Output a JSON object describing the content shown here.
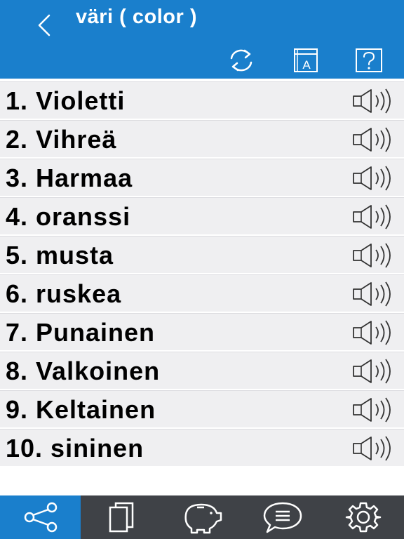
{
  "header": {
    "title": "väri ( color )"
  },
  "toolbar": {
    "back_icon": "chevron-left-icon",
    "refresh_icon": "refresh-icon",
    "dictionary_icon": "dictionary-icon",
    "help_icon": "help-icon"
  },
  "words": [
    {
      "label": "1. Violetti"
    },
    {
      "label": "2. Vihreä"
    },
    {
      "label": "3. Harmaa"
    },
    {
      "label": "4. oranssi"
    },
    {
      "label": "5. musta"
    },
    {
      "label": "6. ruskea"
    },
    {
      "label": "7. Punainen"
    },
    {
      "label": "8. Valkoinen"
    },
    {
      "label": "9. Keltainen"
    },
    {
      "label": "10. sininen"
    }
  ],
  "bottom_nav": [
    {
      "icon": "share-icon",
      "active": true
    },
    {
      "icon": "cards-icon",
      "active": false
    },
    {
      "icon": "piggy-bank-icon",
      "active": false
    },
    {
      "icon": "chat-icon",
      "active": false
    },
    {
      "icon": "settings-icon",
      "active": false
    }
  ],
  "colors": {
    "header": "#1a7fcc",
    "bottom_bar": "#3f4247",
    "row": "#efeff1"
  }
}
